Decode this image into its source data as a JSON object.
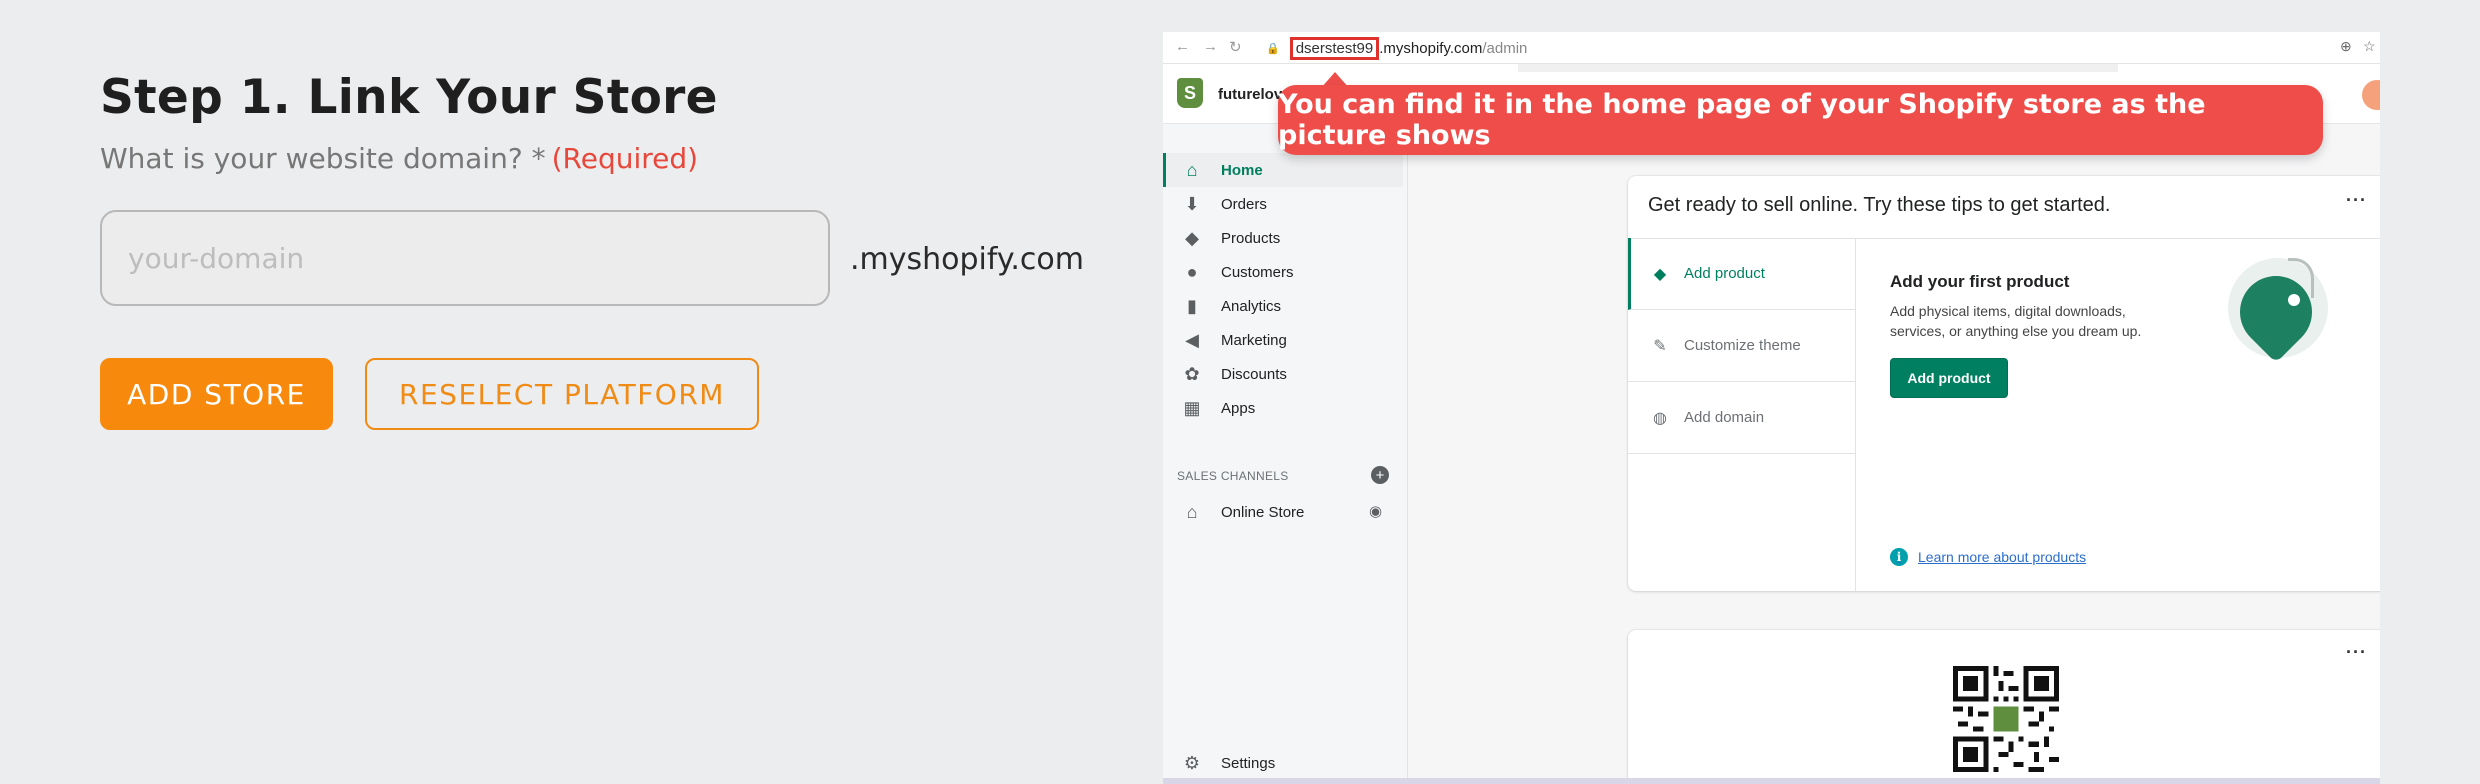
{
  "form": {
    "title": "Step 1. Link Your Store",
    "question": "What is your website domain? *",
    "required": "(Required)",
    "domain_placeholder": "your-domain",
    "domain_value": "",
    "domain_suffix": ".myshopify.com",
    "add_store_label": "ADD STORE",
    "reselect_label": "RESELECT PLATFORM"
  },
  "screenshot": {
    "browser": {
      "url_host_highlight": "dserstest99",
      "url_rest": ".myshopify.com",
      "url_path": "/admin"
    },
    "store_name": "futurelove",
    "callout": "You can find it in the home page of your Shopify store as the picture shows",
    "sidebar": {
      "items": [
        {
          "label": "Home",
          "icon": "home-icon",
          "active": true
        },
        {
          "label": "Orders",
          "icon": "orders-icon"
        },
        {
          "label": "Products",
          "icon": "tag-icon"
        },
        {
          "label": "Customers",
          "icon": "person-icon"
        },
        {
          "label": "Analytics",
          "icon": "bar-chart-icon"
        },
        {
          "label": "Marketing",
          "icon": "megaphone-icon"
        },
        {
          "label": "Discounts",
          "icon": "discount-icon"
        },
        {
          "label": "Apps",
          "icon": "apps-icon"
        }
      ],
      "sales_channels_heading": "SALES CHANNELS",
      "online_store": "Online Store",
      "settings": "Settings"
    },
    "tips_card": {
      "title": "Get ready to sell online. Try these tips to get started.",
      "tabs": [
        "Add product",
        "Customize theme",
        "Add domain"
      ],
      "panel_title": "Add your first product",
      "panel_desc": "Add physical items, digital downloads, services, or anything else you dream up.",
      "button": "Add product",
      "learn_more": "Learn more about products"
    }
  },
  "colors": {
    "accent_orange": "#f78a0d",
    "required_red": "#e8473b",
    "callout_red": "#ee4d4a",
    "shopify_green": "#008060"
  }
}
